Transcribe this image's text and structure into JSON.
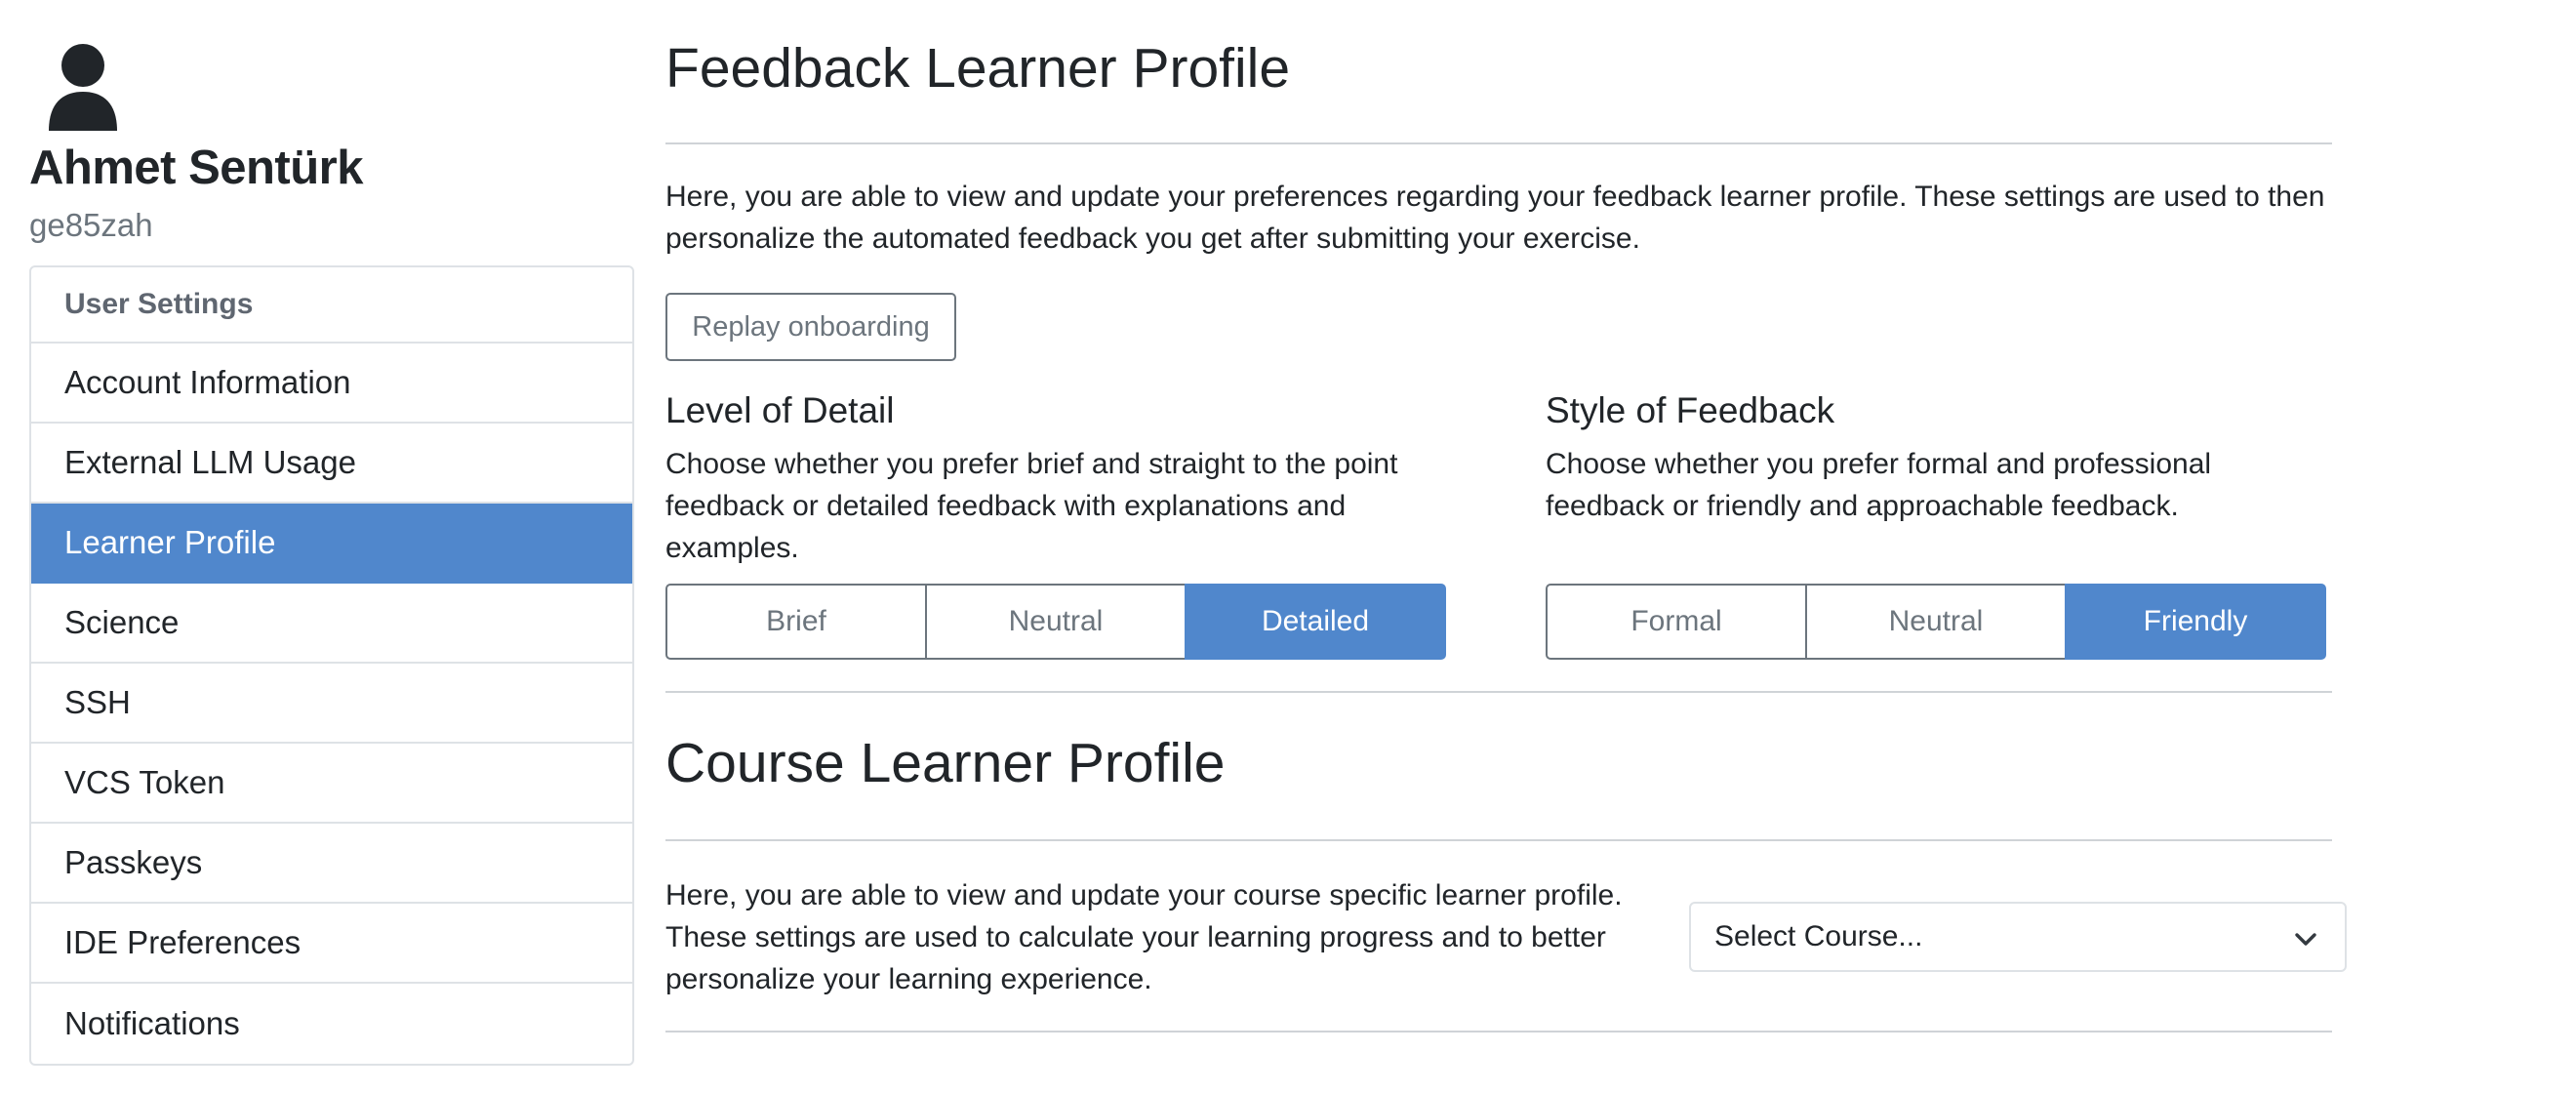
{
  "sidebar": {
    "user_name": "Ahmet Sentürk",
    "user_login": "ge85zah",
    "header": "User Settings",
    "items": [
      {
        "label": "Account Information",
        "active": false
      },
      {
        "label": "External LLM Usage",
        "active": false
      },
      {
        "label": "Learner Profile",
        "active": true
      },
      {
        "label": "Science",
        "active": false
      },
      {
        "label": "SSH",
        "active": false
      },
      {
        "label": "VCS Token",
        "active": false
      },
      {
        "label": "Passkeys",
        "active": false
      },
      {
        "label": "IDE Preferences",
        "active": false
      },
      {
        "label": "Notifications",
        "active": false
      }
    ]
  },
  "feedback_profile": {
    "title": "Feedback Learner Profile",
    "description": "Here, you are able to view and update your preferences regarding your feedback learner profile. These settings are used to then personalize the automated feedback you get after submitting your exercise.",
    "replay_button": "Replay onboarding",
    "level_of_detail": {
      "title": "Level of Detail",
      "description": "Choose whether you prefer brief and straight to the point feedback or detailed feedback with explanations and examples.",
      "options": [
        "Brief",
        "Neutral",
        "Detailed"
      ],
      "selected": "Detailed"
    },
    "style_of_feedback": {
      "title": "Style of Feedback",
      "description": "Choose whether you prefer formal and professional feedback or friendly and approachable feedback.",
      "options": [
        "Formal",
        "Neutral",
        "Friendly"
      ],
      "selected": "Friendly"
    }
  },
  "course_profile": {
    "title": "Course Learner Profile",
    "description": "Here, you are able to view and update your course specific learner profile. These settings are used to calculate your learning progress and to better personalize your learning experience.",
    "select_value": "Select Course..."
  },
  "colors": {
    "accent": "#5087cc",
    "muted_text": "#6c757d",
    "border": "#dee2e6"
  },
  "icons": {
    "avatar": "user-silhouette-icon",
    "select": "chevron-down-icon"
  }
}
